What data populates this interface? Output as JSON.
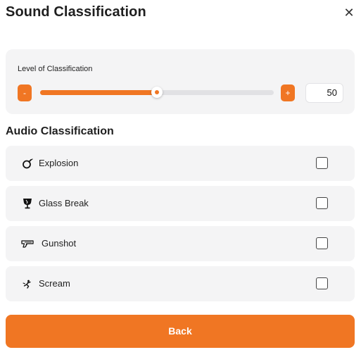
{
  "header": {
    "title": "Sound Classification",
    "close_icon": "close-icon"
  },
  "level": {
    "label": "Level of Classification",
    "minus_label": "-",
    "plus_label": "+",
    "value": "50",
    "fraction": 0.5
  },
  "section": {
    "title": "Audio Classification"
  },
  "items": [
    {
      "label": "Explosion",
      "icon": "bomb-icon",
      "checked": false
    },
    {
      "label": "Glass Break",
      "icon": "broken-glass-icon",
      "checked": false
    },
    {
      "label": "Gunshot",
      "icon": "gun-icon",
      "checked": false
    },
    {
      "label": "Scream",
      "icon": "scream-icon",
      "checked": false
    }
  ],
  "footer": {
    "back_label": "Back"
  },
  "colors": {
    "accent": "#f07623",
    "card_bg": "#f4f4f5"
  }
}
